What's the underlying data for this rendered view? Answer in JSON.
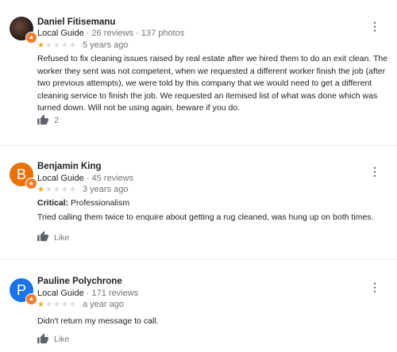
{
  "reviews": [
    {
      "name": "Daniel Fitisemanu",
      "guide_label": "Local Guide",
      "meta_rest": " · 26 reviews · 137 photos",
      "rating": 1,
      "time_ago": "5 years ago",
      "text": "Refused to fix cleaning issues raised by real estate after we hired them to do an exit clean.  The worker they sent was not competent, when we requested a different worker finish the job (after two previous attempts), we were told by this company that we would need to get a different cleaning service to finish the job.  We requested an itemised list of what was done which was turned down.  Will not be using again,  beware if you do.",
      "likes": "2"
    },
    {
      "name": "Benjamin King",
      "avatar_letter": "B",
      "avatar_color": "#e8710a",
      "guide_label": "Local Guide",
      "meta_rest": " · 45 reviews",
      "rating": 1,
      "time_ago": "3 years ago",
      "critical_label": "Critical:",
      "critical_value": " Professionalism",
      "text": "Tried calling them twice to enquire about getting a rug cleaned, was hung up on both times.",
      "likes": "Like"
    },
    {
      "name": "Pauline Polychrone",
      "avatar_letter": "P",
      "avatar_color": "#1a73e8",
      "guide_label": "Local Guide",
      "meta_rest": " · 171 reviews",
      "rating": 1,
      "time_ago": "a year ago",
      "text": "Didn't return my message to call.",
      "likes": "Like"
    }
  ],
  "icons": {
    "star_char": "★",
    "menu_char": "⋮",
    "badge_char": "★"
  },
  "colors": {
    "star": "#f5a623",
    "star_empty": "#dadce0"
  }
}
